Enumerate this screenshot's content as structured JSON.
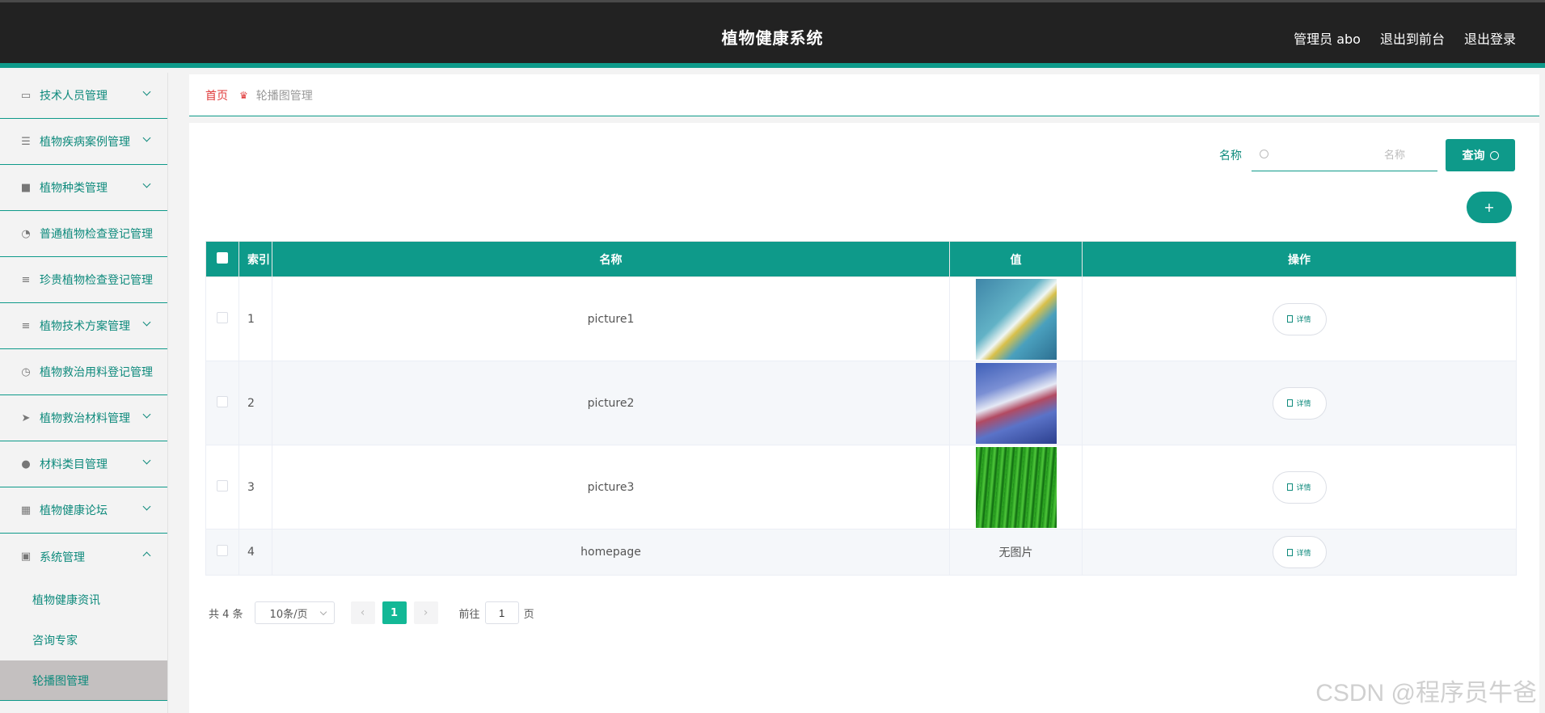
{
  "header": {
    "title": "植物健康系统",
    "admin_label": "管理员 abo",
    "frontend_link": "退出到前台",
    "logout_link": "退出登录"
  },
  "sidebar": {
    "items": [
      {
        "label": "技术人员管理",
        "icon": "chat-icon"
      },
      {
        "label": "植物疾病案例管理",
        "icon": "sliders-icon"
      },
      {
        "label": "植物种类管理",
        "icon": "box-icon"
      },
      {
        "label": "普通植物检查登记管理",
        "icon": "gauge-icon"
      },
      {
        "label": "珍贵植物检查登记管理",
        "icon": "list-icon"
      },
      {
        "label": "植物技术方案管理",
        "icon": "list-indent-icon"
      },
      {
        "label": "植物救治用料登记管理",
        "icon": "compass-icon"
      },
      {
        "label": "植物救治材料管理",
        "icon": "send-icon"
      },
      {
        "label": "材料类目管理",
        "icon": "user-icon"
      },
      {
        "label": "植物健康论坛",
        "icon": "grid-icon"
      },
      {
        "label": "系统管理",
        "icon": "clipboard-icon"
      }
    ],
    "sub_items": [
      {
        "label": "植物健康资讯"
      },
      {
        "label": "咨询专家"
      },
      {
        "label": "轮播图管理"
      }
    ]
  },
  "breadcrumb": {
    "home": "首页",
    "current": "轮播图管理"
  },
  "search": {
    "label": "名称",
    "placeholder": "名称",
    "button": "查询"
  },
  "add_button": "+",
  "table": {
    "columns": [
      "索引",
      "名称",
      "值",
      "操作"
    ],
    "rows": [
      {
        "index": "1",
        "name": "picture1",
        "value": "image"
      },
      {
        "index": "2",
        "name": "picture2",
        "value": "image"
      },
      {
        "index": "3",
        "name": "picture3",
        "value": "image"
      },
      {
        "index": "4",
        "name": "homepage",
        "value": "无图片"
      }
    ],
    "detail_label": "详情"
  },
  "pager": {
    "total": "共 4 条",
    "page_size": "10条/页",
    "prev": "‹",
    "current_page": "1",
    "next": "›",
    "goto_label": "前往",
    "goto_value": "1",
    "page_suffix": "页"
  },
  "watermark": "CSDN @程序员牛爸",
  "colors": {
    "accent": "#0e9a8a",
    "header_bg": "#222222",
    "breadcrumb_home": "#e03a3a",
    "pager_active": "#13b896"
  }
}
